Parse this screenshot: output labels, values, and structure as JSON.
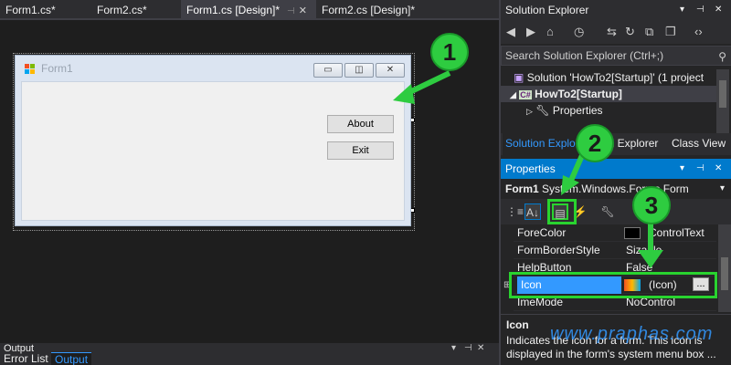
{
  "tabs": [
    {
      "label": "Form1.cs*",
      "active": false
    },
    {
      "label": "Form2.cs*",
      "active": false
    },
    {
      "label": "Form1.cs [Design]*",
      "active": true
    },
    {
      "label": "Form2.cs [Design]*",
      "active": false
    }
  ],
  "form": {
    "title": "Form1",
    "about_label": "About",
    "exit_label": "Exit"
  },
  "annotations": {
    "badge1": "1",
    "badge2": "2",
    "badge3": "3"
  },
  "output": {
    "title": "Output",
    "tabs": [
      "Error List",
      "Output"
    ]
  },
  "solution_explorer": {
    "title": "Solution Explorer",
    "search_placeholder": "Search Solution Explorer (Ctrl+;)",
    "tree": [
      {
        "label": "Solution 'HowTo2[Startup]' (1 project"
      },
      {
        "label": "HowTo2[Startup]"
      },
      {
        "label": "Properties"
      }
    ],
    "tabs": [
      "Solution Explo...",
      "Team Explorer",
      "Class View"
    ]
  },
  "properties": {
    "title": "Properties",
    "object_name": "Form1",
    "object_type": "System.Windows.Forms.Form",
    "rows": [
      {
        "name": "ForeColor",
        "value": "ControlText"
      },
      {
        "name": "FormBorderStyle",
        "value": "Sizable"
      },
      {
        "name": "HelpButton",
        "value": "False"
      },
      {
        "name": "Icon",
        "value": "(Icon)"
      },
      {
        "name": "ImeMode",
        "value": "NoControl"
      }
    ],
    "ellipsis": "...",
    "desc_title": "Icon",
    "desc_text": "Indicates the icon for a form. This icon is displayed in the form's system menu box ..."
  },
  "watermark": "www.praphas.com",
  "colors": {
    "accent": "#007acc",
    "highlight": "#29d32f",
    "selection": "#3399ff"
  }
}
